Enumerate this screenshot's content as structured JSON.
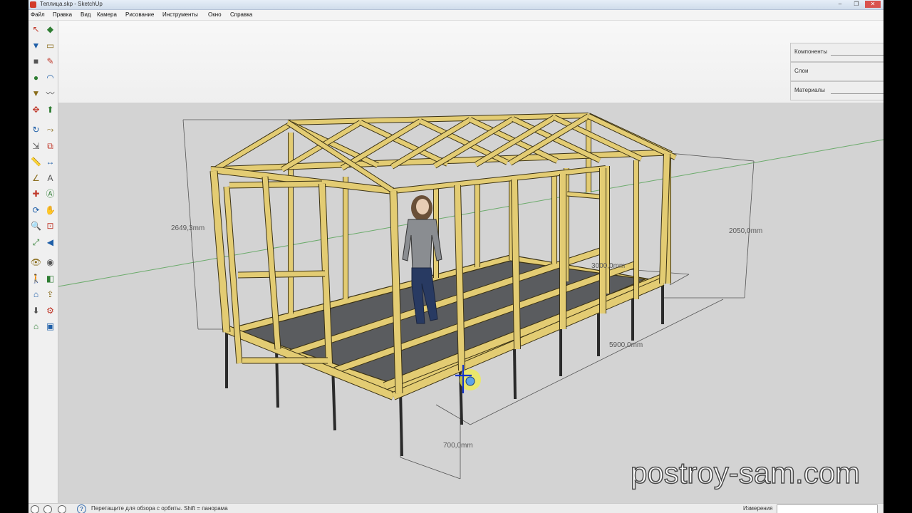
{
  "window": {
    "title": "Теплица.skp - SketchUp",
    "buttons": [
      "–",
      "❐",
      "✕"
    ]
  },
  "menu": [
    "Файл",
    "Правка",
    "Вид",
    "Камера",
    "Рисование",
    "Инструменты",
    "Окно",
    "Справка"
  ],
  "tray": [
    {
      "label": "Компоненты"
    },
    {
      "label": "Слои"
    },
    {
      "label": "Материалы"
    }
  ],
  "tools": [
    "select-icon",
    "component-icon",
    "paint-bucket-icon",
    "eraser-icon",
    "rectangle-icon",
    "pencil-icon",
    "circle-icon",
    "arc-icon",
    "polygon-icon",
    "freehand-icon",
    "move-icon",
    "push-pull-icon",
    "rotate-icon",
    "follow-me-icon",
    "scale-icon",
    "offset-icon",
    "tape-measure-icon",
    "dimension-icon",
    "protractor-icon",
    "text-icon",
    "axes-icon",
    "3d-text-icon",
    "orbit-icon",
    "pan-icon",
    "zoom-icon",
    "zoom-window-icon",
    "zoom-extents-icon",
    "previous-view-icon",
    "position-camera-icon",
    "look-around-icon",
    "walk-icon",
    "section-plane-icon",
    "warehouse-icon",
    "share-model-icon",
    "get-models-icon",
    "extension-icon",
    "house-icon",
    "photo-icon"
  ],
  "dimensions": {
    "height_left": "2649,3mm",
    "height_right": "2050,0mm",
    "width": "3000,0mm",
    "length": "5900,0mm",
    "post": "700,0mm"
  },
  "status": {
    "hint": "Перетащите для обзора с орбиты. Shift = панорама",
    "measure_label": "Измерения",
    "measure_value": ""
  },
  "watermark": "postroy-sam.com",
  "colors": {
    "wood": "#e3cc73",
    "wood_edge": "#3b3214",
    "floor": "#5a5c5f",
    "sky": "#f7f7f7",
    "ground": "#d3d3d3",
    "person_shirt": "#8a8d91",
    "person_pants": "#283a62"
  }
}
